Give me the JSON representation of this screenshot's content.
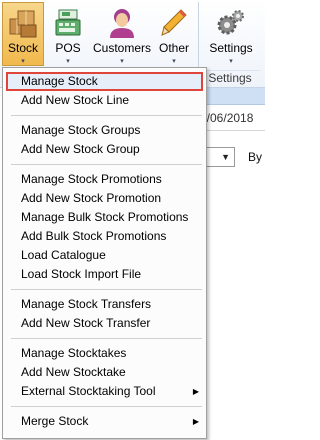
{
  "ribbon": {
    "buttons": [
      {
        "label": "Stock",
        "icon": "stock-boxes-icon"
      },
      {
        "label": "POS",
        "icon": "cash-register-icon"
      },
      {
        "label": "Customers",
        "icon": "customer-icon"
      },
      {
        "label": "Other",
        "icon": "pencil-icon"
      },
      {
        "label": "Settings",
        "icon": "gears-icon"
      }
    ],
    "group_label": "Settings",
    "dropdown_arrow": "▾"
  },
  "background": {
    "date_text": "7/06/2018",
    "combo_chevron": "▼",
    "by_label": "By"
  },
  "menu": {
    "submenu_arrow": "▶",
    "items": [
      {
        "label": "Manage Stock",
        "selected": true
      },
      {
        "label": "Add New Stock Line"
      },
      {
        "label": "Manage Stock Groups"
      },
      {
        "label": "Add New Stock Group"
      },
      {
        "label": "Manage Stock Promotions"
      },
      {
        "label": "Add New Stock Promotion"
      },
      {
        "label": "Manage Bulk Stock Promotions"
      },
      {
        "label": "Add Bulk Stock Promotions"
      },
      {
        "label": "Load Catalogue"
      },
      {
        "label": "Load Stock Import File"
      },
      {
        "label": "Manage Stock Transfers"
      },
      {
        "label": "Add New Stock Transfer"
      },
      {
        "label": "Manage Stocktakes"
      },
      {
        "label": "Add New Stocktake"
      },
      {
        "label": "External Stocktaking Tool",
        "submenu": true
      },
      {
        "label": "Merge Stock",
        "submenu": true
      }
    ]
  },
  "colors": {
    "highlight_border": "#e0453c",
    "ribbon_active": "#f1b94d",
    "ribbon_border": "#c6d4e6"
  }
}
